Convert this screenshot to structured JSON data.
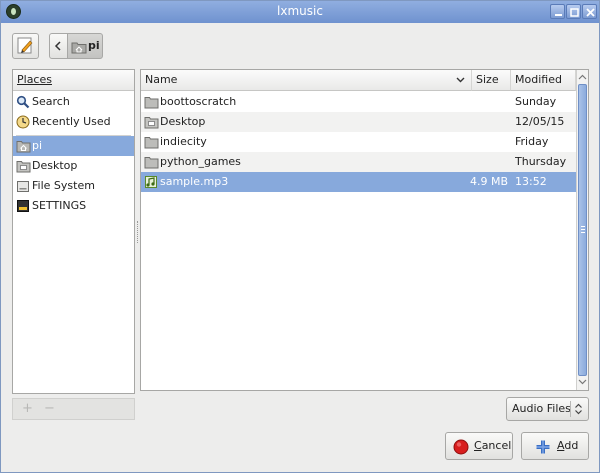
{
  "window": {
    "title": "lxmusic"
  },
  "path_bar": {
    "current_folder": "pi"
  },
  "places": {
    "header": "Places",
    "items": [
      {
        "label": "Search",
        "icon": "search-icon"
      },
      {
        "label": "Recently Used",
        "icon": "clock-icon"
      },
      {
        "label": "pi",
        "icon": "home-folder-icon",
        "selected": true
      },
      {
        "label": "Desktop",
        "icon": "desktop-folder-icon"
      },
      {
        "label": "File System",
        "icon": "drive-icon"
      },
      {
        "label": "SETTINGS",
        "icon": "removable-drive-icon"
      }
    ],
    "add_symbol": "+",
    "remove_symbol": "−"
  },
  "files": {
    "columns": {
      "name": "Name",
      "size": "Size",
      "modified": "Modified"
    },
    "rows": [
      {
        "name": "boottoscratch",
        "size": "",
        "modified": "Sunday",
        "icon": "folder-icon"
      },
      {
        "name": "Desktop",
        "size": "",
        "modified": "12/05/15",
        "icon": "desktop-folder-icon"
      },
      {
        "name": "indiecity",
        "size": "",
        "modified": "Friday",
        "icon": "folder-icon"
      },
      {
        "name": "python_games",
        "size": "",
        "modified": "Thursday",
        "icon": "folder-icon"
      },
      {
        "name": "sample.mp3",
        "size": "4.9 MB",
        "modified": "13:52",
        "icon": "audio-file-icon",
        "selected": true
      }
    ]
  },
  "filter": {
    "selected": "Audio Files"
  },
  "buttons": {
    "cancel_prefix": "C",
    "cancel_rest": "ancel",
    "add_prefix": "A",
    "add_rest": "dd"
  },
  "colors": {
    "selection": "#87a9dc",
    "titlebar": "#7b9ad4",
    "cancel_red": "#d81e1e",
    "add_blue": "#3a6fc4"
  }
}
